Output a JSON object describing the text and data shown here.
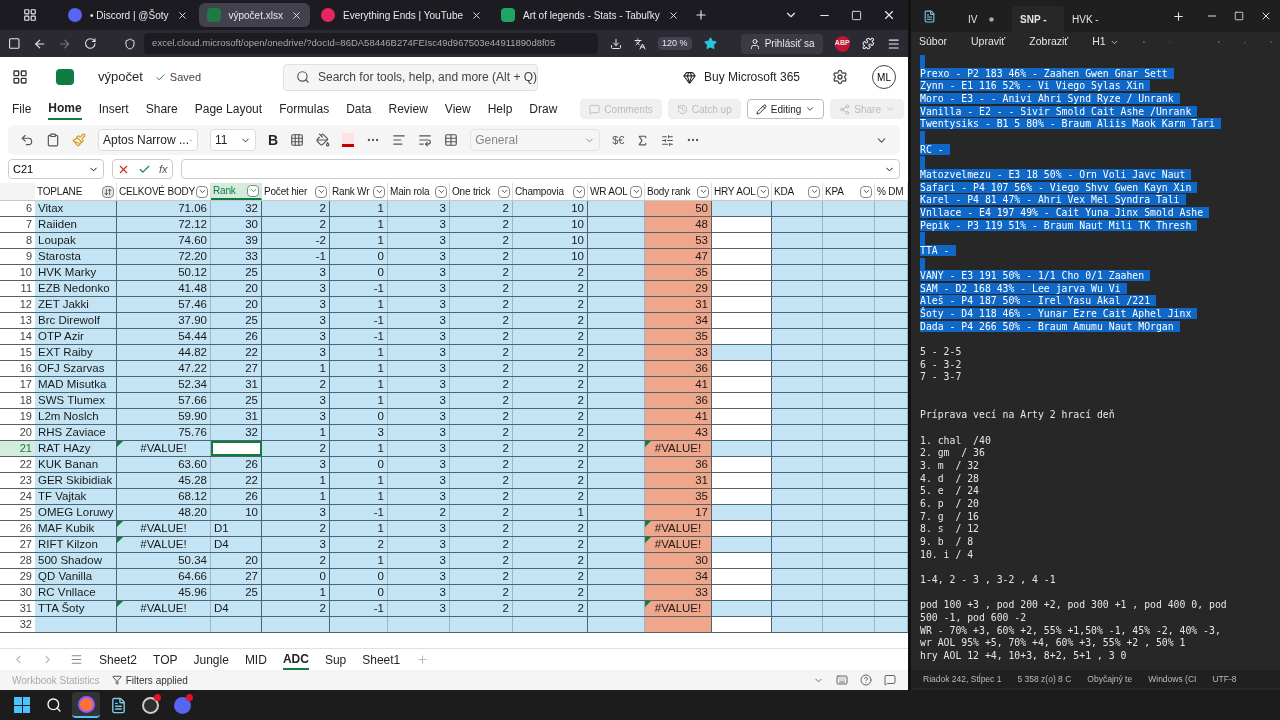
{
  "browser": {
    "tabs": [
      {
        "kind": "discord",
        "label": "• Discord | @Šoty",
        "selected": false
      },
      {
        "kind": "excel",
        "label": "výpočet.xlsx",
        "selected": true
      },
      {
        "kind": "youtube",
        "label": "Everything Ends | YouTube",
        "selected": false
      },
      {
        "kind": "sheets",
        "label": "Art of legends - Stats - Tabuľky",
        "selected": false
      }
    ],
    "address": "excel.cloud.microsoft/open/onedrive/?docId=86DA58446B274FEIsc49d967503e44911890d8f05",
    "zoom": "120 %",
    "sign_in": "Prihlásiť sa",
    "extension_badge": "ABP"
  },
  "excel": {
    "file_name": "výpočet",
    "save_status": "Saved",
    "search_placeholder": "Search for tools, help, and more (Alt + Q)",
    "buy_button": "Buy Microsoft 365",
    "avatar": "ML",
    "ribbon_tabs": [
      {
        "label": "File",
        "selected": false
      },
      {
        "label": "Home",
        "selected": true
      },
      {
        "label": "Insert",
        "selected": false
      },
      {
        "label": "Share",
        "selected": false
      },
      {
        "label": "Page Layout",
        "selected": false
      },
      {
        "label": "Formulas",
        "selected": false
      },
      {
        "label": "Data",
        "selected": false
      },
      {
        "label": "Review",
        "selected": false
      },
      {
        "label": "View",
        "selected": false
      },
      {
        "label": "Help",
        "selected": false
      },
      {
        "label": "Draw",
        "selected": false
      }
    ],
    "ribbon_actions": [
      {
        "kind": "comments",
        "label": "Comments",
        "disabled": true
      },
      {
        "kind": "catchup",
        "label": "Catch up",
        "disabled": true
      },
      {
        "kind": "editing",
        "label": "Editing",
        "disabled": false
      },
      {
        "kind": "share",
        "label": "Share",
        "disabled": true
      }
    ],
    "toolbar": {
      "font": "Aptos Narrow ...",
      "font_size": "11",
      "bold": "B",
      "number_format": "General",
      "currency": "$€"
    },
    "formula_bar": {
      "cell": "C21",
      "function_label": "fx"
    },
    "sheet": {
      "columns": [
        {
          "label": "TOPLANE",
          "color": "#c3e4f4",
          "selected": false,
          "sorted": true
        },
        {
          "label": "CELKOVÉ BODY",
          "color": "#c3e4f4",
          "selected": false,
          "sorted": false
        },
        {
          "label": "Rank",
          "color": "#c3e4f4",
          "selected": true,
          "sorted": false
        },
        {
          "label": "Počet hier",
          "color": "#c3e4f4",
          "selected": false,
          "sorted": false
        },
        {
          "label": "Rank Wr",
          "color": "#c3e4f4",
          "selected": false,
          "sorted": false
        },
        {
          "label": "Main rola",
          "color": "#c3e4f4",
          "selected": false,
          "sorted": false
        },
        {
          "label": "One trick",
          "color": "#c3e4f4",
          "selected": false,
          "sorted": false
        },
        {
          "label": "Champovia",
          "color": "#c3e4f4",
          "selected": false,
          "sorted": false
        },
        {
          "label": "WR AOL",
          "color": "#c3e4f4",
          "selected": false,
          "sorted": false
        },
        {
          "label": "Body rank",
          "color": "#efa68a",
          "selected": false,
          "sorted": false
        },
        {
          "label": "HRY AOL",
          "color": "#c3e4f4",
          "selected": false,
          "sorted": false
        },
        {
          "label": "KDA",
          "color": "#c3e4f4",
          "selected": false,
          "sorted": false
        },
        {
          "label": "KPA",
          "color": "#c3e4f4",
          "selected": false,
          "sorted": false
        },
        {
          "label": "% DM",
          "color": "#c3e4f4",
          "selected": false,
          "sorted": false
        }
      ],
      "rows": [
        {
          "number": "6",
          "cells": [
            "Vitax",
            "71.06",
            "32",
            "2",
            "1",
            "3",
            "2",
            "10",
            null,
            "50"
          ],
          "flag": false,
          "selected": false,
          "hry_aol_white": false
        },
        {
          "number": "7",
          "cells": [
            "Raiiden",
            "72.12",
            "30",
            "2",
            "1",
            "3",
            "2",
            "10",
            null,
            "48"
          ],
          "flag": false,
          "selected": false,
          "hry_aol_white": true
        },
        {
          "number": "8",
          "cells": [
            "Loupak",
            "74.60",
            "39",
            "-2",
            "1",
            "3",
            "2",
            "10",
            null,
            "53"
          ],
          "flag": false,
          "selected": false,
          "hry_aol_white": true
        },
        {
          "number": "9",
          "cells": [
            "Starosta",
            "72.20",
            "33",
            "-1",
            "0",
            "3",
            "2",
            "10",
            null,
            "47"
          ],
          "flag": false,
          "selected": false,
          "hry_aol_white": true
        },
        {
          "number": "10",
          "cells": [
            "HVK Marky",
            "50.12",
            "25",
            "3",
            "0",
            "3",
            "2",
            "2",
            null,
            "35"
          ],
          "flag": false,
          "selected": false,
          "hry_aol_white": true
        },
        {
          "number": "11",
          "cells": [
            "EZB Nedonko",
            "41.48",
            "20",
            "3",
            "-1",
            "3",
            "2",
            "2",
            null,
            "29"
          ],
          "flag": false,
          "selected": false,
          "hry_aol_white": true
        },
        {
          "number": "12",
          "cells": [
            "ZET Jakki",
            "57.46",
            "20",
            "3",
            "1",
            "3",
            "2",
            "2",
            null,
            "31"
          ],
          "flag": false,
          "selected": false,
          "hry_aol_white": true
        },
        {
          "number": "13",
          "cells": [
            "Brc Direwolf",
            "37.90",
            "25",
            "3",
            "-1",
            "3",
            "2",
            "2",
            null,
            "34"
          ],
          "flag": false,
          "selected": false,
          "hry_aol_white": true
        },
        {
          "number": "14",
          "cells": [
            "OTP Azir",
            "54.44",
            "26",
            "3",
            "-1",
            "3",
            "2",
            "2",
            null,
            "35"
          ],
          "flag": false,
          "selected": false,
          "hry_aol_white": true
        },
        {
          "number": "15",
          "cells": [
            "EXT Raiby",
            "44.82",
            "22",
            "3",
            "1",
            "3",
            "2",
            "2",
            null,
            "33"
          ],
          "flag": false,
          "selected": false,
          "hry_aol_white": false
        },
        {
          "number": "16",
          "cells": [
            "OFJ Szarvas",
            "47.22",
            "27",
            "1",
            "1",
            "3",
            "2",
            "2",
            null,
            "36"
          ],
          "flag": false,
          "selected": false,
          "hry_aol_white": true
        },
        {
          "number": "17",
          "cells": [
            "MAD Misutka",
            "52.34",
            "31",
            "2",
            "1",
            "3",
            "2",
            "2",
            null,
            "41"
          ],
          "flag": false,
          "selected": false,
          "hry_aol_white": true
        },
        {
          "number": "18",
          "cells": [
            "SWS Tlumex",
            "57.66",
            "25",
            "3",
            "1",
            "3",
            "2",
            "2",
            null,
            "36"
          ],
          "flag": false,
          "selected": false,
          "hry_aol_white": true
        },
        {
          "number": "19",
          "cells": [
            "L2m Noslch",
            "59.90",
            "31",
            "3",
            "0",
            "3",
            "2",
            "2",
            null,
            "41"
          ],
          "flag": false,
          "selected": false,
          "hry_aol_white": true
        },
        {
          "number": "20",
          "cells": [
            "RHS Zaviace",
            "75.76",
            "32",
            "1",
            "3",
            "3",
            "2",
            "2",
            null,
            "43"
          ],
          "flag": false,
          "selected": false,
          "hry_aol_white": true
        },
        {
          "number": "21",
          "cells": [
            "RAT HAzy",
            "#VALUE!",
            null,
            "2",
            "1",
            "3",
            "2",
            "2",
            null,
            "#VALUE!"
          ],
          "flag": true,
          "selected": true,
          "hry_aol_white": false
        },
        {
          "number": "22",
          "cells": [
            "KUK Banan",
            "63.60",
            "26",
            "3",
            "0",
            "3",
            "2",
            "2",
            null,
            "36"
          ],
          "flag": false,
          "selected": false,
          "hry_aol_white": true
        },
        {
          "number": "23",
          "cells": [
            "GER Skibidiak",
            "45.28",
            "22",
            "1",
            "1",
            "3",
            "2",
            "2",
            null,
            "31"
          ],
          "flag": false,
          "selected": false,
          "hry_aol_white": true
        },
        {
          "number": "24",
          "cells": [
            "TF Vajtak",
            "68.12",
            "26",
            "1",
            "1",
            "3",
            "2",
            "2",
            null,
            "35"
          ],
          "flag": false,
          "selected": false,
          "hry_aol_white": true
        },
        {
          "number": "25",
          "cells": [
            "OMEG Loruwy",
            "48.20",
            "10",
            "3",
            "-1",
            "2",
            "2",
            "1",
            null,
            "17"
          ],
          "flag": false,
          "selected": false,
          "hry_aol_white": false
        },
        {
          "number": "26",
          "cells": [
            "MAF Kubik",
            "#VALUE!",
            "D1",
            "2",
            "1",
            "3",
            "2",
            "2",
            null,
            "#VALUE!"
          ],
          "flag": true,
          "selected": false,
          "hry_aol_white": true
        },
        {
          "number": "27",
          "cells": [
            "RIFT Kilzon",
            "#VALUE!",
            "D4",
            "3",
            "2",
            "3",
            "2",
            "2",
            null,
            "#VALUE!"
          ],
          "flag": true,
          "selected": false,
          "hry_aol_white": false
        },
        {
          "number": "28",
          "cells": [
            "500 Shadow",
            "50.34",
            "20",
            "2",
            "1",
            "3",
            "2",
            "2",
            null,
            "30"
          ],
          "flag": false,
          "selected": false,
          "hry_aol_white": true
        },
        {
          "number": "29",
          "cells": [
            "QD Vanilla",
            "64.66",
            "27",
            "0",
            "0",
            "3",
            "2",
            "2",
            null,
            "34"
          ],
          "flag": false,
          "selected": false,
          "hry_aol_white": true
        },
        {
          "number": "30",
          "cells": [
            "RC Vnllace",
            "45.96",
            "25",
            "1",
            "0",
            "3",
            "2",
            "2",
            null,
            "33"
          ],
          "flag": false,
          "selected": false,
          "hry_aol_white": true
        },
        {
          "number": "31",
          "cells": [
            "TTA Šoty",
            "#VALUE!",
            "D4",
            "2",
            "-1",
            "3",
            "2",
            "2",
            null,
            "#VALUE!"
          ],
          "flag": true,
          "selected": false,
          "hry_aol_white": false
        },
        {
          "number": "32",
          "cells": [],
          "flag": false,
          "selected": false,
          "hry_aol_white": true
        }
      ]
    },
    "sheet_tabs": [
      {
        "label": "Sheet2",
        "selected": false
      },
      {
        "label": "TOP",
        "selected": false
      },
      {
        "label": "Jungle",
        "selected": false
      },
      {
        "label": "MID",
        "selected": false
      },
      {
        "label": "ADC",
        "selected": true
      },
      {
        "label": "Sup",
        "selected": false
      },
      {
        "label": "Sheet1",
        "selected": false
      }
    ],
    "status_bar": [
      {
        "label": "Workbook Statistics",
        "disabled": true
      },
      {
        "label": "Filters applied",
        "disabled": false
      }
    ]
  },
  "notepad": {
    "tabs": [
      {
        "label": "IV",
        "selected": false
      },
      {
        "label": "SNP -",
        "selected": true
      },
      {
        "label": "HVK -",
        "selected": false
      }
    ],
    "menu": [
      "Súbor",
      "Upraviť",
      "Zobraziť"
    ],
    "heading_menu": "H1",
    "lines": [
      {
        "selected": true
      },
      {
        "text": "Prexo - P2 183 46% - Zaahen Gwen Gnar Sett",
        "selected": true
      },
      {
        "text": "Zynn - E1 116 52% - Vi Viego Sylas Xin",
        "selected": true
      },
      {
        "text": "Moro - E3 - - Anivi Ahri Synd Ryze / Unrank",
        "selected": true
      },
      {
        "text": "Vanilla - E2 - - Sivir Smold Cait Ashe /Unrank",
        "selected": true
      },
      {
        "text": "Twentysiks - B1 5 80% - Braum Aliis Maok Karm Tari",
        "selected": true
      },
      {
        "selected": true
      },
      {
        "text": "RC -",
        "selected": true
      },
      {
        "selected": true
      },
      {
        "text": "Matozvelmezu - E3 18 50% - Orn Voli Javc Naut",
        "selected": true
      },
      {
        "text": "Safari - P4 107 56% - Viego Shvv Gwen Kayn Xin",
        "selected": true
      },
      {
        "text": "Karel - P4 81 47% - Ahri Vex Mel Syndra Tali",
        "selected": true
      },
      {
        "text": "Vnllace - E4 197 49% - Cait Yuna Jinx Smold Ashe",
        "selected": true
      },
      {
        "text": "Pepik - P3 119 51% - Braum Naut Mili TK Thresh",
        "selected": true
      },
      {
        "selected": true
      },
      {
        "text": "TTA -",
        "selected": true
      },
      {
        "selected": true
      },
      {
        "text": "VANY - E3 191 50% - 1/1 Cho 0/1 Zaahen",
        "selected": true
      },
      {
        "text": "SAM - D2 168 43% - Lee jarva Wu Vi",
        "selected": true
      },
      {
        "text": "Aleš - P4 187 50% - Irel Yasu Akal /221",
        "selected": true
      },
      {
        "text": "Šoty - D4 118 46% - Yunar Ezre Cait Aphel Jinx",
        "selected": true
      },
      {
        "text": "Dada - P4 266 50% - Braum Amumu Naut MOrgan",
        "selected": true
      },
      {
        "selected": false
      },
      {
        "text": "5 - 2-5",
        "selected": false
      },
      {
        "text": "6 - 3-2",
        "selected": false
      },
      {
        "text": "7 - 3-7",
        "selected": false
      },
      {
        "selected": false
      },
      {
        "selected": false
      },
      {
        "text": "Príprava vecí na Arty 2 hrací deň",
        "selected": false
      },
      {
        "selected": false
      },
      {
        "text": "1. chal  /40",
        "selected": false
      },
      {
        "text": "2. gm  / 36",
        "selected": false
      },
      {
        "text": "3. m  / 32",
        "selected": false
      },
      {
        "text": "4. d  / 28",
        "selected": false
      },
      {
        "text": "5. e  / 24",
        "selected": false
      },
      {
        "text": "6. p  / 20",
        "selected": false
      },
      {
        "text": "7. g  / 16",
        "selected": false
      },
      {
        "text": "8. s  / 12",
        "selected": false
      },
      {
        "text": "9. b  / 8",
        "selected": false
      },
      {
        "text": "10. i / 4",
        "selected": false
      },
      {
        "selected": false
      },
      {
        "text": "1-4, 2 - 3 , 3-2 , 4 -1",
        "selected": false
      },
      {
        "selected": false
      },
      {
        "text": "pod 100 +3 , pod 200 +2, pod 300 +1 , pod 400 0, pod",
        "selected": false
      },
      {
        "text": "500 -1, pod 600 -2",
        "selected": false
      },
      {
        "text": "WR - 70% +3, 60% +2, 55% +1,50% -1, 45% -2, 40% -3,",
        "selected": false
      },
      {
        "text": "wr AOL 95% +5, 70% +4, 60% +3, 55% +2 , 50% 1",
        "selected": false
      },
      {
        "text": "hry AOL 12 +4, 10+3, 8+2, 5+1 , 3 0",
        "selected": false
      }
    ],
    "status_bar": [
      "Riadok 242, Stĺpec 1",
      "5 358 z(o) 8 C",
      "Obyčajný te",
      "Windows (CI",
      "UTF-8"
    ]
  },
  "taskbar": [
    {
      "kind": "start",
      "active": false,
      "badge": false
    },
    {
      "kind": "search",
      "active": false,
      "badge": false
    },
    {
      "kind": "browser",
      "active": true,
      "badge": false
    },
    {
      "kind": "notepad",
      "active": false,
      "badge": false
    },
    {
      "kind": "recorder",
      "active": false,
      "badge": true
    },
    {
      "kind": "chat",
      "active": false,
      "badge": true
    }
  ]
}
